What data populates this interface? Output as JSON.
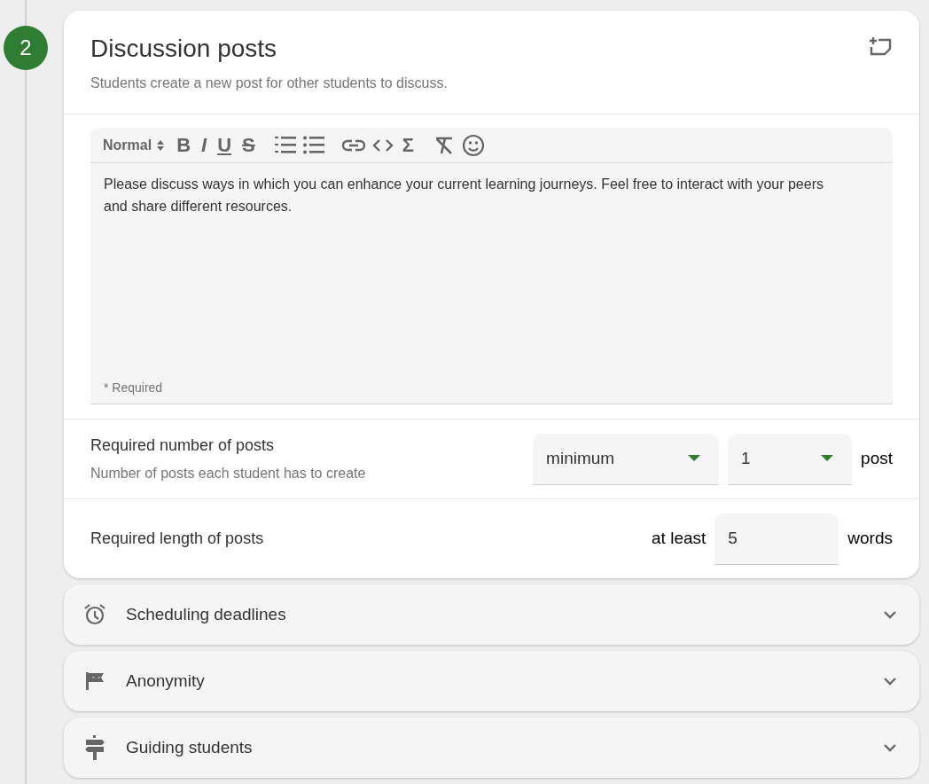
{
  "step": {
    "number": "2"
  },
  "card": {
    "title": "Discussion posts",
    "subtitle": "Students create a new post for other students to discuss."
  },
  "editor": {
    "toolbar": [
      {
        "kind": "format",
        "label": "Normal"
      },
      {
        "kind": "bold",
        "label": "B"
      },
      {
        "kind": "italic",
        "label": "I"
      },
      {
        "kind": "underline",
        "label": "U"
      },
      {
        "kind": "strike",
        "label": "S"
      },
      {
        "kind": "ordered-list"
      },
      {
        "kind": "bullet-list"
      },
      {
        "kind": "link"
      },
      {
        "kind": "code"
      },
      {
        "kind": "formula",
        "label": "Σ"
      },
      {
        "kind": "clear-format"
      },
      {
        "kind": "emoji"
      }
    ],
    "value": "Please discuss ways in which you can enhance your current learning journeys. Feel free to interact with your peers and share different resources.",
    "helper": "* Required"
  },
  "required_posts": {
    "label": "Required number of posts",
    "hint": "Number of posts each student has to create",
    "mode": "minimum",
    "count": "1",
    "unit": "post"
  },
  "required_length": {
    "label": "Required length of posts",
    "prefix": "at least",
    "value": "5",
    "unit": "words"
  },
  "sections": [
    {
      "kind": "alarm",
      "label": "Scheduling deadlines",
      "expanded": false
    },
    {
      "kind": "mask",
      "label": "Anonymity",
      "expanded": false
    },
    {
      "kind": "signpost",
      "label": "Guiding students",
      "expanded": false
    }
  ]
}
